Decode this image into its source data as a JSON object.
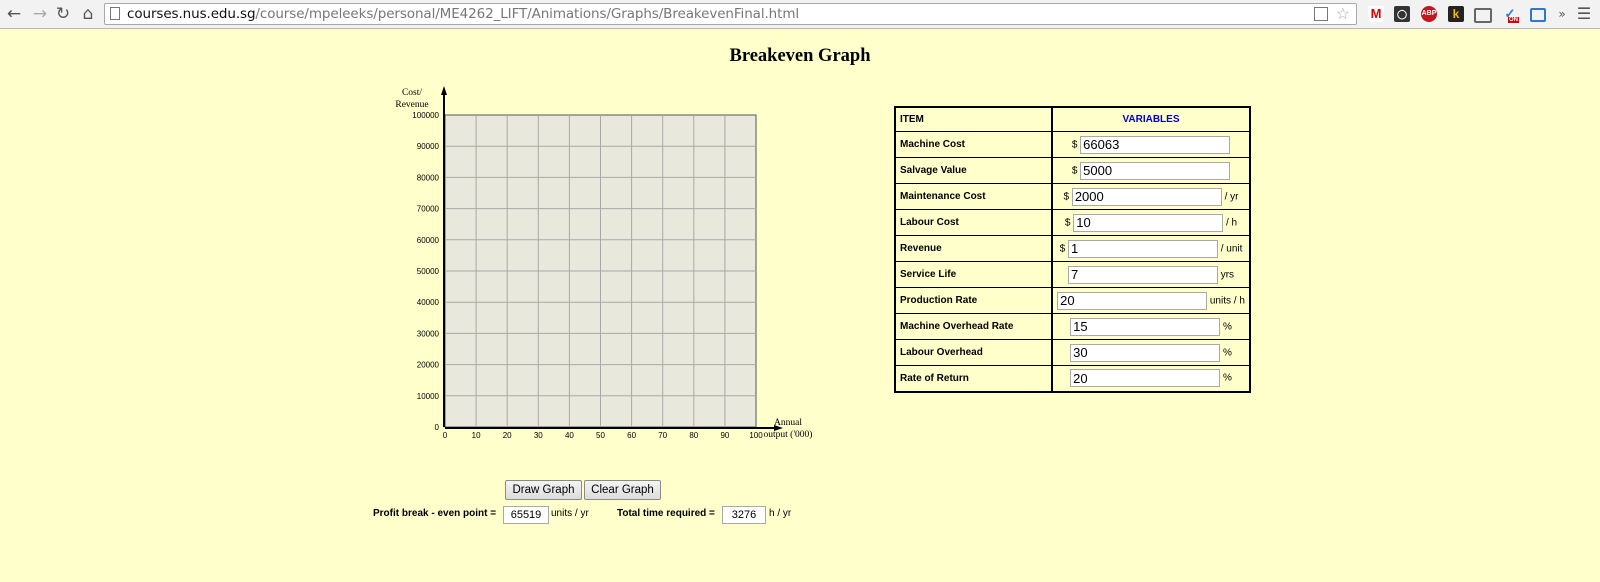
{
  "browser": {
    "url_host": "courses.nus.edu.sg",
    "url_path": "/course/mpeleeks/personal/ME4262_LIFT/Animations/Graphs/BreakevenFinal.html",
    "extensions": [
      "gmail-icon",
      "incognito-icon",
      "adblock-icon",
      "k-icon",
      "cast-icon",
      "check-on-icon",
      "screen-icon"
    ],
    "overflow": "»"
  },
  "page": {
    "title": "Breakeven Graph"
  },
  "chart_data": {
    "type": "line",
    "series": [],
    "ylabel_line1": "Cost/",
    "ylabel_line2": "Revenue",
    "xlabel_line1": "Annual",
    "xlabel_line2": "output ('000)",
    "xlim": [
      0,
      100
    ],
    "ylim": [
      0,
      100000
    ],
    "x_ticks": [
      "0",
      "10",
      "20",
      "30",
      "40",
      "50",
      "60",
      "70",
      "80",
      "90",
      "100"
    ],
    "y_ticks": [
      "0",
      "10000",
      "20000",
      "30000",
      "40000",
      "50000",
      "60000",
      "70000",
      "80000",
      "90000",
      "100000"
    ],
    "grid": true,
    "grid_color": "#a8a8a8",
    "plot_bg": "#e8e8dc"
  },
  "table": {
    "col_item": "ITEM",
    "col_variables": "VARIABLES",
    "rows": [
      {
        "label": "Machine Cost",
        "prefix": "$",
        "value": "66063",
        "unit": ""
      },
      {
        "label": "Salvage Value",
        "prefix": "$",
        "value": "5000",
        "unit": ""
      },
      {
        "label": "Maintenance Cost",
        "prefix": "$",
        "value": "2000",
        "unit": "/ yr"
      },
      {
        "label": "Labour Cost",
        "prefix": "$",
        "value": "10",
        "unit": "/ h"
      },
      {
        "label": "Revenue",
        "prefix": "$",
        "value": "1",
        "unit": "/ unit"
      },
      {
        "label": "Service Life",
        "prefix": "",
        "value": "7",
        "unit": "yrs"
      },
      {
        "label": "Production Rate",
        "prefix": "",
        "value": "20",
        "unit": "units / h"
      },
      {
        "label": "Machine Overhead Rate",
        "prefix": "",
        "value": "15",
        "unit": "%"
      },
      {
        "label": "Labour Overhead",
        "prefix": "",
        "value": "30",
        "unit": "%"
      },
      {
        "label": "Rate of Return",
        "prefix": "",
        "value": "20",
        "unit": "%"
      }
    ]
  },
  "buttons": {
    "draw": "Draw Graph",
    "clear": "Clear Graph"
  },
  "results": {
    "breakeven_label": "Profit break - even point =",
    "breakeven_value": "65519",
    "breakeven_unit": "units / yr",
    "time_label": "Total time required =",
    "time_value": "3276",
    "time_unit": "h / yr"
  }
}
